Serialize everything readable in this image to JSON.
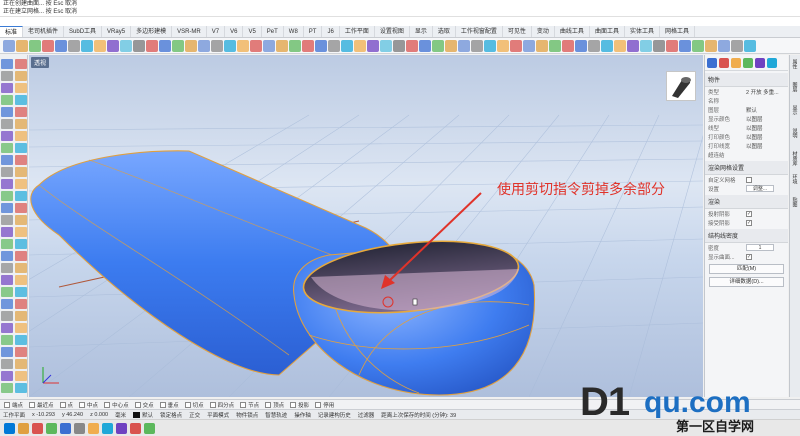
{
  "command_history": {
    "lines": [
      "正在创建曲面... 按 Esc 取消",
      "正在建立网格... 按 Esc 取消"
    ]
  },
  "tabs": [
    "标准",
    "工作平面",
    "设置视图",
    "显示",
    "选取",
    "工作视窗配置",
    "可见性",
    "变动",
    "曲线工具",
    "曲面工具",
    "实体工具",
    "网格工具",
    "渲染工具",
    "出图",
    "V6 的新功能"
  ],
  "top_tabs": [
    "标准",
    "老司机插件",
    "SubD工具",
    "VRay5",
    "多边形建模",
    "VSR-MR",
    "V7",
    "V6",
    "V5",
    "PeT",
    "W8",
    "PT",
    "J6",
    "工作平面",
    "设置视图",
    "显示",
    "选取",
    "工作视窗配置",
    "可见性",
    "变动",
    "曲线工具",
    "曲面工具",
    "实体工具",
    "网格工具"
  ],
  "viewport": {
    "label": "透视",
    "annotation": "使用剪切指令剪掉多余部分"
  },
  "properties": {
    "title": "物件",
    "rows": [
      {
        "k": "类型",
        "v": "2 开放 多重..."
      },
      {
        "k": "名称",
        "v": ""
      },
      {
        "k": "图层",
        "v": "默认"
      },
      {
        "k": "显示颜色",
        "v": "以图层"
      },
      {
        "k": "线型",
        "v": "以图层"
      },
      {
        "k": "打印颜色",
        "v": "以图层"
      },
      {
        "k": "打印线宽",
        "v": "以图层"
      },
      {
        "k": "超连结",
        "v": ""
      }
    ],
    "render_mesh_section": "渲染网格设置",
    "custom_mesh_label": "自定义网格",
    "settings_label": "设置",
    "adjust_label": "调整...",
    "render_section": "渲染",
    "cast_shadow": "投射阴影",
    "receive_shadow": "接受阴影",
    "isocurve_section": "结构线密度",
    "density_label": "密度",
    "density_value": "1",
    "show_surface_isocurve": "显示曲面...",
    "match_button": "匹配(M)",
    "details_button": "详细数据(D)..."
  },
  "vertical_tabs": [
    "属性",
    "图层",
    "显示",
    "说明",
    "材质库",
    "环境",
    "贴图"
  ],
  "osnap": [
    "端点",
    "最近点",
    "点",
    "中点",
    "中心点",
    "交点",
    "垂点",
    "切点",
    "四分点",
    "节点",
    "顶点",
    "投影",
    "停用"
  ],
  "status": {
    "workplane": "工作平面",
    "x": "x -10.293",
    "y": "y 46.240",
    "z": "z 0.000",
    "unit": "毫米",
    "layer": "默认",
    "lock_grid": "锁定格点",
    "ortho": "正交",
    "planar": "平面模式",
    "osnap": "物件锁点",
    "smarttrack": "智慧轨迹",
    "gumball": "操作轴",
    "record_history": "记录建构历史",
    "filter": "过滤器",
    "autosave": "距离上次保存的时间 (分钟): 39"
  },
  "watermark": {
    "brand_d1": "D1",
    "brand_qu": "qu.com",
    "subtitle": "第一区自学网"
  }
}
